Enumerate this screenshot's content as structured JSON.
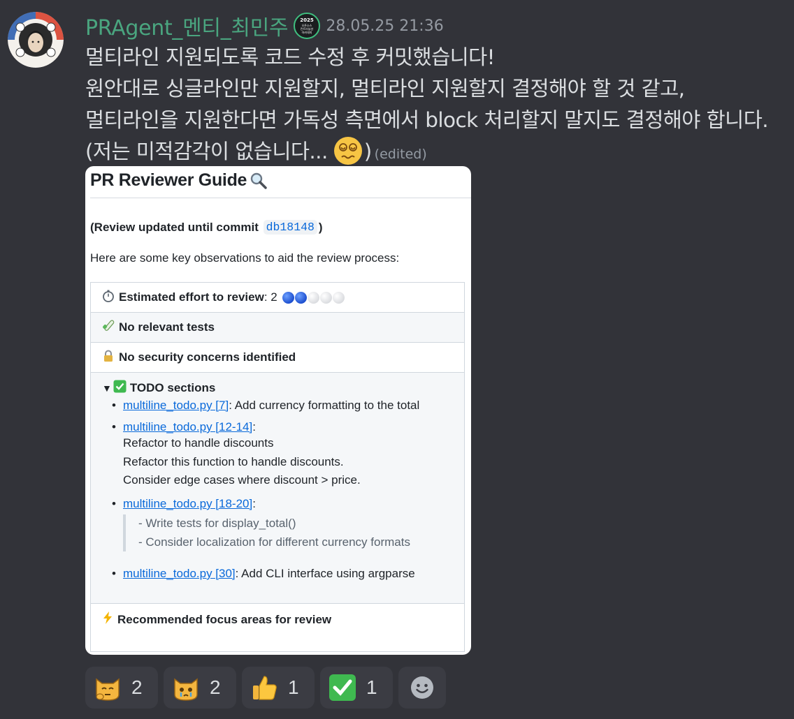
{
  "message": {
    "username": "PRAgent_멘티_최민주",
    "timestamp": "28.05.25 21:36",
    "badge_lines": [
      "2025",
      "오픈소스",
      "컨트리뷰션",
      "아카데미"
    ],
    "lines": [
      "멀티라인 지원되도록 코드 수정 후 커밋했습니다!",
      "원안대로 싱글라인만 지원할지, 멀티라인 지원할지 결정해야 할 것 같고,",
      "멀티라인을 지원한다면 가독성 측면에서 block 처리할지 말지도 결정해야 합니다."
    ],
    "last_line_prefix": "(저는 미적감각이 없습니다...",
    "last_line_suffix": ")",
    "edited": "(edited)"
  },
  "card": {
    "title": "PR Reviewer Guide",
    "review_prefix": "(Review updated until commit",
    "commit": "db18148",
    "review_suffix": ")",
    "intro": "Here are some key observations to aid the review process:",
    "effort_label": "Estimated effort to review",
    "effort_value": "2",
    "effort_score": 2,
    "effort_max": 5,
    "tests": "No relevant tests",
    "security": "No security concerns identified",
    "todo_title": "TODO sections",
    "todos": [
      {
        "link": "multiline_todo.py [7]",
        "text": ": Add currency formatting to the total"
      },
      {
        "link": "multiline_todo.py [12-14]",
        "text": ":",
        "lines": [
          "Refactor to handle discounts",
          "Refactor this function to handle discounts.",
          "Consider edge cases where discount > price."
        ]
      },
      {
        "link": "multiline_todo.py [18-20]",
        "text": ":",
        "quote": [
          "- Write tests for display_total()",
          "- Consider localization for different currency formats"
        ]
      },
      {
        "link": "multiline_todo.py [30]",
        "text": ": Add CLI interface using argparse"
      }
    ],
    "focus": "Recommended focus areas for review"
  },
  "reactions": [
    {
      "icon": "cat-thinking-icon",
      "count": "2"
    },
    {
      "icon": "cat-crying-icon",
      "count": "2"
    },
    {
      "icon": "thumbs-up-icon",
      "count": "1"
    },
    {
      "icon": "check-mark-icon",
      "count": "1"
    }
  ],
  "colors": {
    "background": "#323339",
    "username": "#4aa57f",
    "link": "#0969da",
    "reaction_bg": "#3b3c43"
  }
}
